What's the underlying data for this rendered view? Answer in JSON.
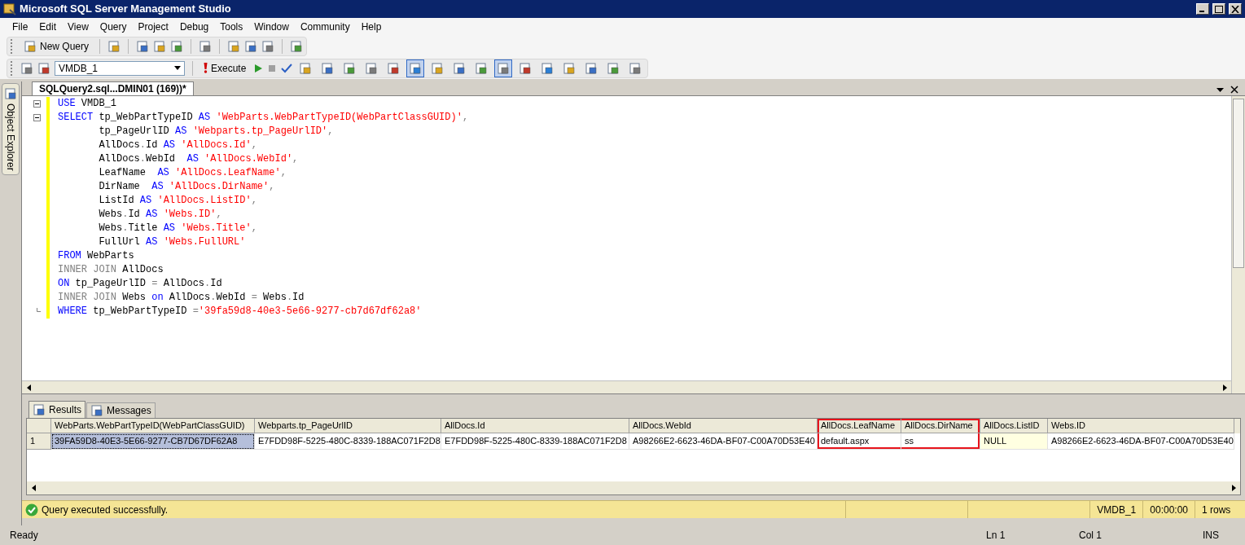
{
  "window": {
    "title": "Microsoft SQL Server Management Studio"
  },
  "menu": [
    "File",
    "Edit",
    "View",
    "Query",
    "Project",
    "Debug",
    "Tools",
    "Window",
    "Community",
    "Help"
  ],
  "toolbar1": {
    "new_query": "New Query"
  },
  "toolbar2": {
    "database": "VMDB_1",
    "execute": "Execute",
    "buttons": [
      {
        "pressed": false
      },
      {
        "pressed": false
      },
      {
        "pressed": false
      },
      {
        "pressed": false
      },
      {
        "pressed": false
      },
      {
        "pressed": true
      },
      {
        "pressed": false
      },
      {
        "pressed": false
      },
      {
        "pressed": false
      },
      {
        "pressed": true
      },
      {
        "pressed": false
      },
      {
        "pressed": false
      },
      {
        "pressed": false
      },
      {
        "pressed": false
      },
      {
        "pressed": false
      },
      {
        "pressed": false
      }
    ]
  },
  "side_tab": "Object Explorer",
  "document_tab": {
    "title": "SQLQuery2.sql...DMIN01 (169))*",
    "selected": true
  },
  "editor": {
    "lines": [
      {
        "kind": "fold-start",
        "tokens": [
          {
            "kind": "kw",
            "text": "USE"
          },
          {
            "kind": "plain",
            "text": " VMDB_1"
          }
        ]
      },
      {
        "kind": "fold-start",
        "tokens": [
          {
            "kind": "kw",
            "text": "SELECT"
          },
          {
            "kind": "plain",
            "text": " tp_WebPartTypeID "
          },
          {
            "kind": "kw",
            "text": "AS"
          },
          {
            "kind": "str",
            "text": " 'WebParts.WebPartTypeID(WebPartClassGUID)'"
          },
          {
            "kind": "op",
            "text": ","
          }
        ]
      },
      {
        "tokens": [
          {
            "kind": "plain",
            "text": "       tp_PageUrlID "
          },
          {
            "kind": "kw",
            "text": "AS"
          },
          {
            "kind": "str",
            "text": " 'Webparts.tp_PageUrlID'"
          },
          {
            "kind": "op",
            "text": ","
          }
        ]
      },
      {
        "tokens": [
          {
            "kind": "plain",
            "text": "       AllDocs"
          },
          {
            "kind": "op",
            "text": "."
          },
          {
            "kind": "plain",
            "text": "Id "
          },
          {
            "kind": "kw",
            "text": "AS"
          },
          {
            "kind": "str",
            "text": " 'AllDocs.Id'"
          },
          {
            "kind": "op",
            "text": ","
          }
        ]
      },
      {
        "tokens": [
          {
            "kind": "plain",
            "text": "       AllDocs"
          },
          {
            "kind": "op",
            "text": "."
          },
          {
            "kind": "plain",
            "text": "WebId  "
          },
          {
            "kind": "kw",
            "text": "AS"
          },
          {
            "kind": "str",
            "text": " 'AllDocs.WebId'"
          },
          {
            "kind": "op",
            "text": ","
          }
        ]
      },
      {
        "tokens": [
          {
            "kind": "plain",
            "text": "       LeafName  "
          },
          {
            "kind": "kw",
            "text": "AS"
          },
          {
            "kind": "str",
            "text": " 'AllDocs.LeafName'"
          },
          {
            "kind": "op",
            "text": ","
          }
        ]
      },
      {
        "tokens": [
          {
            "kind": "plain",
            "text": "       DirName  "
          },
          {
            "kind": "kw",
            "text": "AS"
          },
          {
            "kind": "str",
            "text": " 'AllDocs.DirName'"
          },
          {
            "kind": "op",
            "text": ","
          }
        ]
      },
      {
        "tokens": [
          {
            "kind": "plain",
            "text": "       ListId "
          },
          {
            "kind": "kw",
            "text": "AS"
          },
          {
            "kind": "str",
            "text": " 'AllDocs.ListID'"
          },
          {
            "kind": "op",
            "text": ","
          }
        ]
      },
      {
        "tokens": [
          {
            "kind": "plain",
            "text": "       Webs"
          },
          {
            "kind": "op",
            "text": "."
          },
          {
            "kind": "plain",
            "text": "Id "
          },
          {
            "kind": "kw",
            "text": "AS"
          },
          {
            "kind": "str",
            "text": " 'Webs.ID'"
          },
          {
            "kind": "op",
            "text": ","
          }
        ]
      },
      {
        "tokens": [
          {
            "kind": "plain",
            "text": "       Webs"
          },
          {
            "kind": "op",
            "text": "."
          },
          {
            "kind": "plain",
            "text": "Title "
          },
          {
            "kind": "kw",
            "text": "AS"
          },
          {
            "kind": "str",
            "text": " 'Webs.Title'"
          },
          {
            "kind": "op",
            "text": ","
          }
        ]
      },
      {
        "tokens": [
          {
            "kind": "plain",
            "text": "       FullUrl "
          },
          {
            "kind": "kw",
            "text": "AS"
          },
          {
            "kind": "str",
            "text": " 'Webs.FullURL'"
          }
        ]
      },
      {
        "tokens": [
          {
            "kind": "kw",
            "text": "FROM"
          },
          {
            "kind": "plain",
            "text": " WebParts"
          }
        ]
      },
      {
        "tokens": [
          {
            "kind": "op",
            "text": "INNER JOIN"
          },
          {
            "kind": "plain",
            "text": " AllDocs"
          }
        ]
      },
      {
        "tokens": [
          {
            "kind": "kw",
            "text": "ON"
          },
          {
            "kind": "plain",
            "text": " tp_PageUrlID "
          },
          {
            "kind": "op",
            "text": "="
          },
          {
            "kind": "plain",
            "text": " AllDocs"
          },
          {
            "kind": "op",
            "text": "."
          },
          {
            "kind": "plain",
            "text": "Id"
          }
        ]
      },
      {
        "tokens": [
          {
            "kind": "op",
            "text": "INNER JOIN"
          },
          {
            "kind": "plain",
            "text": " Webs "
          },
          {
            "kind": "kw",
            "text": "on"
          },
          {
            "kind": "plain",
            "text": " AllDocs"
          },
          {
            "kind": "op",
            "text": "."
          },
          {
            "kind": "plain",
            "text": "WebId "
          },
          {
            "kind": "op",
            "text": "="
          },
          {
            "kind": "plain",
            "text": " Webs"
          },
          {
            "kind": "op",
            "text": "."
          },
          {
            "kind": "plain",
            "text": "Id"
          }
        ]
      },
      {
        "kind": "fold-end",
        "tokens": [
          {
            "kind": "kw",
            "text": "WHERE"
          },
          {
            "kind": "plain",
            "text": " tp_WebPartTypeID "
          },
          {
            "kind": "op",
            "text": "="
          },
          {
            "kind": "str",
            "text": "'39fa59d8-40e3-5e66-9277-cb7d67df62a8'"
          }
        ]
      }
    ]
  },
  "result_tabs": [
    {
      "label": "Results",
      "selected": true
    },
    {
      "label": "Messages",
      "selected": false
    }
  ],
  "grid": {
    "columns": [
      {
        "label": "WebParts.WebPartTypeID(WebPartClassGUID)",
        "highlighted": false
      },
      {
        "label": "Webparts.tp_PageUrlID",
        "highlighted": false
      },
      {
        "label": "AllDocs.Id",
        "highlighted": false
      },
      {
        "label": "AllDocs.WebId",
        "highlighted": false
      },
      {
        "label": "AllDocs.LeafName",
        "highlighted": true
      },
      {
        "label": "AllDocs.DirName",
        "highlighted": true
      },
      {
        "label": "AllDocs.ListID",
        "highlighted": false
      },
      {
        "label": "Webs.ID",
        "highlighted": false
      }
    ],
    "rows": [
      {
        "number": "1",
        "cells": [
          {
            "text": "39FA59D8-40E3-5E66-9277-CB7D67DF62A8",
            "kind": "value",
            "selected": true
          },
          {
            "text": "E7FDD98F-5225-480C-8339-188AC071F2D8",
            "kind": "value",
            "selected": false
          },
          {
            "text": "E7FDD98F-5225-480C-8339-188AC071F2D8",
            "kind": "value",
            "selected": false
          },
          {
            "text": "A98266E2-6623-46DA-BF07-C00A70D53E40",
            "kind": "value",
            "selected": false
          },
          {
            "text": "default.aspx",
            "kind": "value",
            "selected": false
          },
          {
            "text": "ss",
            "kind": "value",
            "selected": false
          },
          {
            "text": "NULL",
            "kind": "null",
            "selected": false
          },
          {
            "text": "A98266E2-6623-46DA-BF07-C00A70D53E40",
            "kind": "value",
            "selected": false
          }
        ]
      }
    ]
  },
  "query_status": {
    "message": "Query executed successfully.",
    "database": "VMDB_1",
    "time": "00:00:00",
    "rows": "1 rows"
  },
  "status_bar": {
    "state": "Ready",
    "line": "Ln 1",
    "column": "Col 1",
    "mode": "INS"
  }
}
